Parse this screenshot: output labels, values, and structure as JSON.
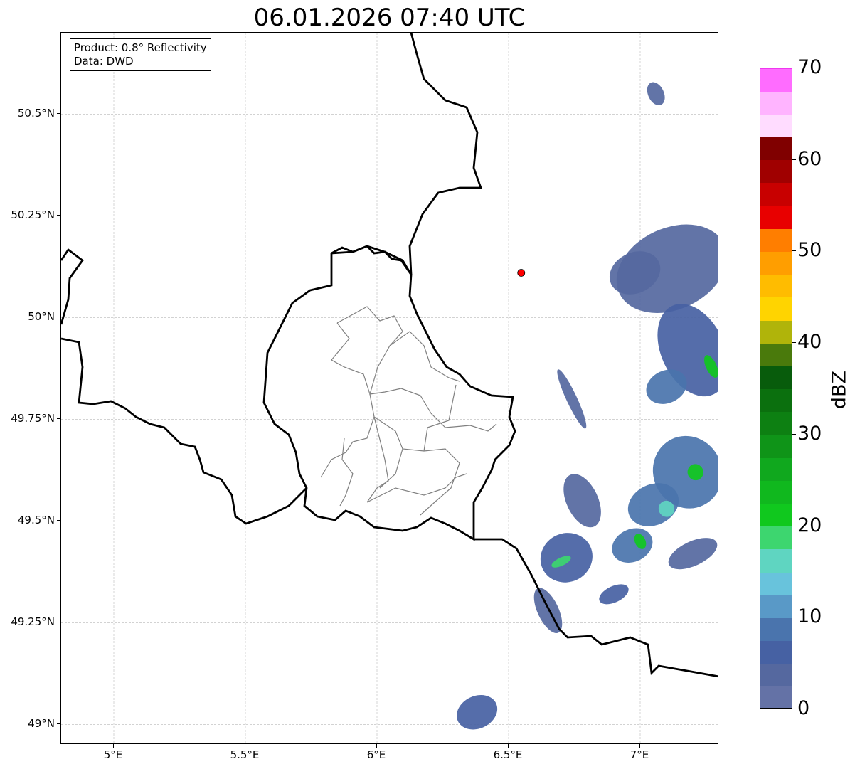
{
  "title": "06.01.2026 07:40 UTC",
  "info": {
    "product": "Product: 0.8° Reflectivity",
    "data_source": "Data: DWD"
  },
  "map": {
    "lon_range": [
      4.8,
      7.3
    ],
    "lat_range": [
      48.95,
      50.7
    ],
    "lat_ticks": [
      "50.5°N",
      "50.25°N",
      "50°N",
      "49.75°N",
      "49.5°N",
      "49.25°N",
      "49°N"
    ],
    "lon_ticks": [
      "5°E",
      "5.5°E",
      "6°E",
      "6.5°E",
      "7°E"
    ],
    "gridlines": true,
    "radar_site": {
      "lon": 6.548,
      "lat": 50.11,
      "color": "#ff0000"
    },
    "reflectivity_areas": [
      {
        "lon": 7.06,
        "lat": 50.55,
        "rlon": 0.03,
        "rlat": 0.03,
        "dbz": 3
      },
      {
        "lon": 7.12,
        "lat": 50.12,
        "rlon": 0.22,
        "rlat": 0.1,
        "dbz": 3
      },
      {
        "lon": 6.98,
        "lat": 50.11,
        "rlon": 0.1,
        "rlat": 0.05,
        "dbz": 4
      },
      {
        "lon": 7.2,
        "lat": 49.92,
        "rlon": 0.12,
        "rlat": 0.12,
        "dbz": 6
      },
      {
        "lon": 7.1,
        "lat": 49.83,
        "rlon": 0.08,
        "rlat": 0.04,
        "dbz": 8
      },
      {
        "lon": 6.74,
        "lat": 49.8,
        "rlon": 0.02,
        "rlat": 0.08,
        "dbz": 3
      },
      {
        "lon": 7.18,
        "lat": 49.62,
        "rlon": 0.13,
        "rlat": 0.09,
        "dbz": 8
      },
      {
        "lon": 7.05,
        "lat": 49.54,
        "rlon": 0.1,
        "rlat": 0.05,
        "dbz": 9
      },
      {
        "lon": 6.78,
        "lat": 49.55,
        "rlon": 0.06,
        "rlat": 0.07,
        "dbz": 4
      },
      {
        "lon": 6.72,
        "lat": 49.41,
        "rlon": 0.1,
        "rlat": 0.06,
        "dbz": 6
      },
      {
        "lon": 6.97,
        "lat": 49.44,
        "rlon": 0.08,
        "rlat": 0.04,
        "dbz": 8
      },
      {
        "lon": 7.2,
        "lat": 49.42,
        "rlon": 0.1,
        "rlat": 0.03,
        "dbz": 4
      },
      {
        "lon": 6.9,
        "lat": 49.32,
        "rlon": 0.06,
        "rlat": 0.02,
        "dbz": 5
      },
      {
        "lon": 6.65,
        "lat": 49.28,
        "rlon": 0.04,
        "rlat": 0.06,
        "dbz": 4
      },
      {
        "lon": 6.38,
        "lat": 49.03,
        "rlon": 0.08,
        "rlat": 0.04,
        "dbz": 5
      },
      {
        "lon": 6.7,
        "lat": 49.4,
        "rlon": 0.04,
        "rlat": 0.01,
        "dbz": 18
      },
      {
        "lon": 7.0,
        "lat": 49.45,
        "rlon": 0.02,
        "rlat": 0.02,
        "dbz": 22
      },
      {
        "lon": 7.27,
        "lat": 49.88,
        "rlon": 0.02,
        "rlat": 0.03,
        "dbz": 22
      },
      {
        "lon": 7.21,
        "lat": 49.62,
        "rlon": 0.03,
        "rlat": 0.02,
        "dbz": 20
      },
      {
        "lon": 7.1,
        "lat": 49.53,
        "rlon": 0.03,
        "rlat": 0.02,
        "dbz": 16
      }
    ]
  },
  "colorbar": {
    "label": "dBZ",
    "ticks": [
      "0",
      "10",
      "20",
      "30",
      "40",
      "50",
      "60",
      "70"
    ],
    "vmin": 0,
    "vmax": 70,
    "step": 2.5,
    "colors": [
      "#6472a6",
      "#55689f",
      "#4661a3",
      "#4a74ad",
      "#5999c7",
      "#68c3dc",
      "#5fd5c1",
      "#3dd66f",
      "#10c81e",
      "#10b81e",
      "#10a81e",
      "#0f9418",
      "#0d8012",
      "#0b700e",
      "#085c0c",
      "#4a7a0c",
      "#b0b40a",
      "#ffd400",
      "#ffbc00",
      "#ff9e00",
      "#ff7e00",
      "#e80000",
      "#c80000",
      "#a00000",
      "#800000",
      "#ffdcff",
      "#ffb4ff",
      "#ff6cff",
      "#ee38ee"
    ]
  }
}
